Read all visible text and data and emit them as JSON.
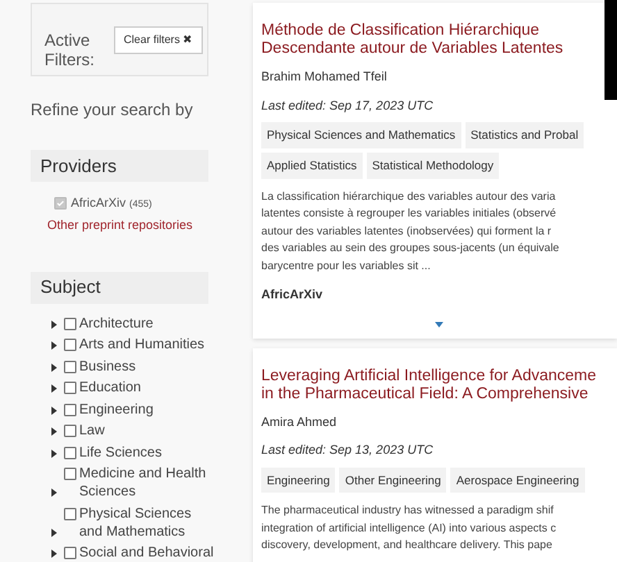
{
  "active_filters": {
    "label": "Active Filters:",
    "clear_button": "Clear filters ✖"
  },
  "refine_heading": "Refine your search by",
  "providers": {
    "heading": "Providers",
    "items": [
      {
        "label": "AfricArXiv",
        "count": "(455)",
        "checked": true,
        "disabled": true
      }
    ],
    "other_link": "Other preprint repositories"
  },
  "subject": {
    "heading": "Subject",
    "items": [
      {
        "label": "Architecture",
        "checked": false
      },
      {
        "label": "Arts and Humanities",
        "checked": false
      },
      {
        "label": "Business",
        "checked": false
      },
      {
        "label": "Education",
        "checked": false
      },
      {
        "label": "Engineering",
        "checked": false
      },
      {
        "label": "Law",
        "checked": false
      },
      {
        "label": "Life Sciences",
        "checked": false
      },
      {
        "label": "Medicine and Health Sciences",
        "checked": false
      },
      {
        "label": "Physical Sciences and Mathematics",
        "checked": false
      },
      {
        "label": "Social and Behavioral",
        "checked": false
      }
    ]
  },
  "results": [
    {
      "title_lines": [
        "Méthode de Classification Hiérarchique",
        "Descendante autour de Variables Latentes"
      ],
      "author": "Brahim Mohamed Tfeil",
      "edited": "Last edited: Sep 17, 2023 UTC",
      "tags": [
        "Physical Sciences and Mathematics",
        "Statistics and Probal",
        "Applied Statistics",
        "Statistical Methodology"
      ],
      "abstract_lines": [
        "La classification hiérarchique des variables autour des varia",
        "latentes consiste à regrouper les variables initiales (observé",
        "autour des variables latentes (inobservées) qui forment la r",
        "des variables au sein des groupes sous-jacents (un équivale",
        "barycentre pour les variables sit ..."
      ],
      "provider": "AfricArXiv",
      "expandable": true
    },
    {
      "title_lines": [
        "Leveraging Artificial Intelligence for Advanceme",
        "in the Pharmaceutical Field: A Comprehensive"
      ],
      "author": "Amira Ahmed",
      "edited": "Last edited: Sep 13, 2023 UTC",
      "tags": [
        "Engineering",
        "Other Engineering",
        "Aerospace Engineering"
      ],
      "abstract_lines": [
        "The pharmaceutical industry has witnessed a paradigm shif",
        "integration of artificial intelligence (AI) into various aspects c",
        "discovery, development, and healthcare delivery. This pape"
      ]
    }
  ]
}
